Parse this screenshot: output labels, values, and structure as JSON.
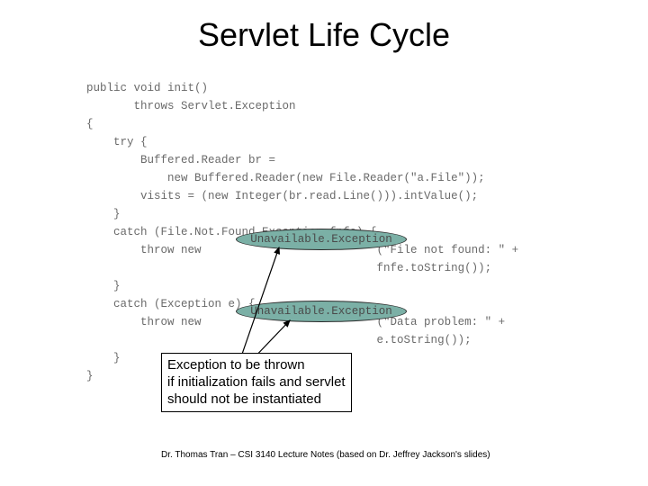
{
  "title": "Servlet Life Cycle",
  "code": {
    "l1": "public void init()",
    "l2": "       throws Servlet.Exception",
    "l3": "{",
    "l4": "    try {",
    "l5": "        Buffered.Reader br =",
    "l6": "            new Buffered.Reader(new File.Reader(\"a.File\"));",
    "l7": "        visits = (new Integer(br.read.Line())).intValue();",
    "l8": "    }",
    "l9": "    catch (File.Not.Found.Exception fnfe) {",
    "l10": "        throw new                          (\"File not found: \" +",
    "l11": "                                           fnfe.toString());",
    "l12": "    }",
    "l13": "    catch (Exception e) {",
    "l14": "        throw new                          (\"Data problem: \" +",
    "l15": "                                           e.toString());",
    "l16": "    }",
    "l17": "}"
  },
  "ellipse_text": "Unavailable.Exception",
  "caption": {
    "line1": "Exception to be thrown",
    "line2": "if initialization fails and servlet",
    "line3": "should not be instantiated"
  },
  "footer": "Dr. Thomas Tran – CSI 3140 Lecture Notes (based on Dr. Jeffrey Jackson's slides)"
}
